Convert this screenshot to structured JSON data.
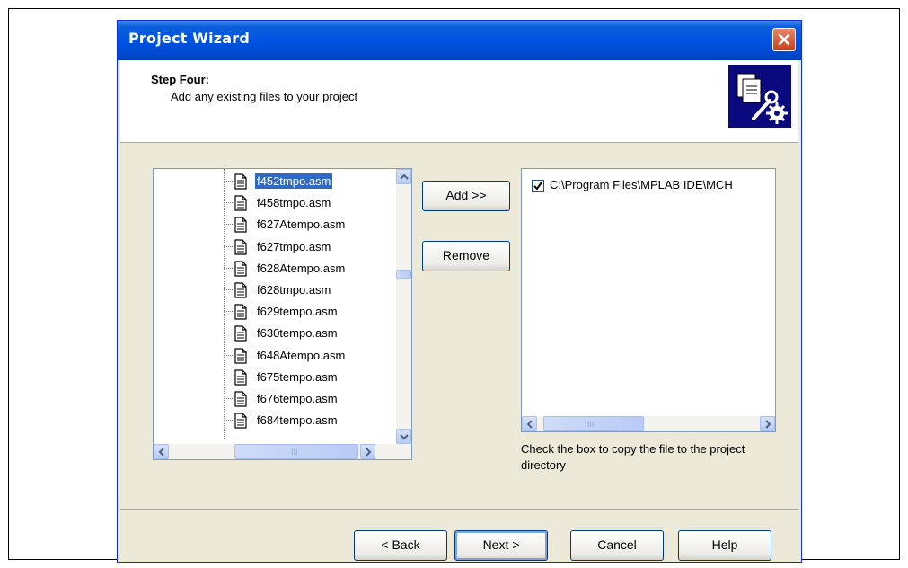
{
  "window": {
    "title": "Project Wizard"
  },
  "header": {
    "step_title": "Step Four:",
    "step_description": "Add any existing files to your project"
  },
  "tree": {
    "selected_index": 0,
    "files": [
      "f452tmpo.asm",
      "f458tmpo.asm",
      "f627Atempo.asm",
      "f627tmpo.asm",
      "f628Atempo.asm",
      "f628tmpo.asm",
      "f629tempo.asm",
      "f630tempo.asm",
      "f648Atempo.asm",
      "f675tempo.asm",
      "f676tempo.asm",
      "f684tempo.asm"
    ]
  },
  "buttons": {
    "add": "Add >>",
    "remove": "Remove",
    "back": "< Back",
    "next": "Next >",
    "cancel": "Cancel",
    "help": "Help"
  },
  "project_files": [
    {
      "path": "C:\\Program Files\\MPLAB IDE\\MCH",
      "copy_checked": true
    }
  ],
  "hint_text": "Check the box to copy the file to the project directory",
  "colors": {
    "titlebar": "#0054e3",
    "selection": "#316ac5",
    "dialog_bg": "#ece9d8",
    "icon_bg": "#0a0a7e"
  },
  "icons": [
    "close-icon",
    "wizard-icon",
    "file-icon",
    "scroll-up-icon",
    "scroll-down-icon",
    "scroll-left-icon",
    "scroll-right-icon",
    "checkmark-icon"
  ]
}
